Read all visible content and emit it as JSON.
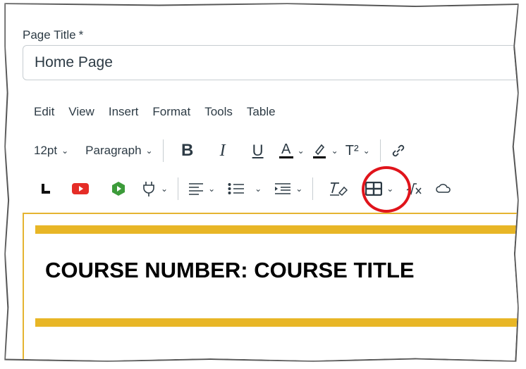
{
  "page_title_label": "Page Title",
  "required_mark": "*",
  "page_title_value": "Home Page",
  "menubar": [
    "Edit",
    "View",
    "Insert",
    "Format",
    "Tools",
    "Table"
  ],
  "toolbar1": {
    "font_size": "12pt",
    "block_format": "Paragraph",
    "bold_glyph": "B",
    "italic_glyph": "I",
    "underline_glyph": "U",
    "text_color_glyph": "A",
    "superscript_glyph": "T²",
    "icons": [
      "bold-icon",
      "italic-icon",
      "underline-icon",
      "text-color-icon",
      "highlight-icon",
      "superscript-icon",
      "link-icon"
    ]
  },
  "toolbar2": {
    "icons": [
      "lti-tool-icon",
      "youtube-icon",
      "media-icon",
      "plugin-icon",
      "align-icon",
      "bullet-list-icon",
      "indent-icon",
      "clear-formatting-icon",
      "table-icon",
      "equation-icon",
      "cloud-icon"
    ]
  },
  "course_heading": "COURSE NUMBER: COURSE TITLE",
  "colors": {
    "accent_gold": "#e8b626",
    "highlight_red": "#e0141b",
    "text": "#2d3b45",
    "youtube_red": "#e52d27",
    "media_green": "#3c9b3a"
  }
}
